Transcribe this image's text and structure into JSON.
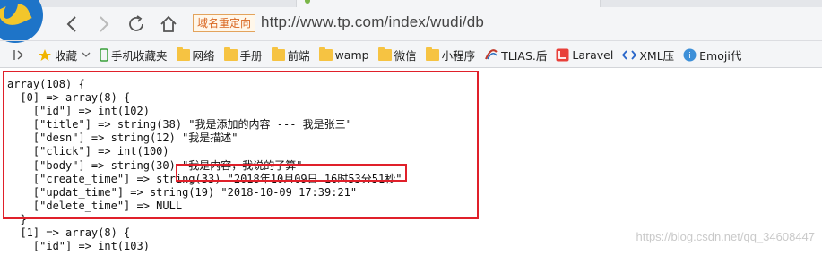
{
  "browser": {
    "redirect_badge": "域名重定向",
    "url": "http://www.tp.com/index/wudi/db",
    "bookmarks": [
      {
        "label": "收藏",
        "icon": "star-icon",
        "has_dropdown": true
      },
      {
        "label": "手机收藏夹",
        "icon": "phone-icon"
      },
      {
        "label": "网络",
        "icon": "folder-icon"
      },
      {
        "label": "手册",
        "icon": "folder-icon"
      },
      {
        "label": "前端",
        "icon": "folder-icon"
      },
      {
        "label": "wamp",
        "icon": "folder-icon"
      },
      {
        "label": "微信",
        "icon": "folder-icon"
      },
      {
        "label": "小程序",
        "icon": "folder-icon"
      },
      {
        "label": "TLIAS.后",
        "icon": "tlias-icon"
      },
      {
        "label": "Laravel",
        "icon": "laravel-icon"
      },
      {
        "label": "XML压",
        "icon": "xml-icon"
      },
      {
        "label": "Emoji代",
        "icon": "emoji-icon"
      }
    ]
  },
  "dump": {
    "lines": [
      "array(108) {",
      "  [0] => array(8) {",
      "    [\"id\"] => int(102)",
      "    [\"title\"] => string(38) \"我是添加的内容 --- 我是张三\"",
      "    [\"desn\"] => string(12) \"我是描述\"",
      "    [\"click\"] => int(100)",
      "    [\"body\"] => string(30) \"我是内容，我说的了算\"",
      "    [\"create_time\"] => string(33) \"2018年10月09日 16时53分51秒\"",
      "    [\"updat_time\"] => string(19) \"2018-10-09 17:39:21\"",
      "    [\"delete_time\"] => NULL",
      "  }",
      "  [1] => array(8) {",
      "    [\"id\"] => int(103)"
    ]
  },
  "watermark": "https://blog.csdn.net/qq_34608447",
  "colors": {
    "highlight_box": "#e0202a",
    "redirect_badge_text": "#d9661f",
    "folder": "#f6c342"
  }
}
